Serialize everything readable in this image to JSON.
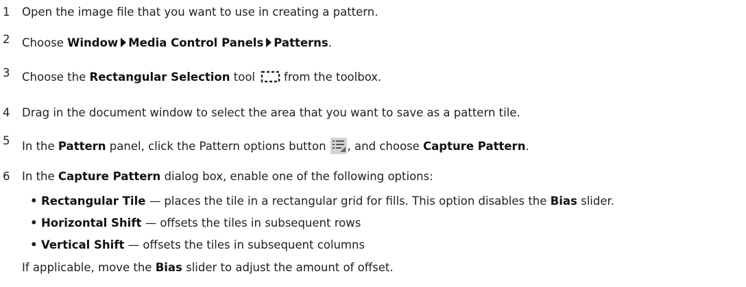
{
  "steps": [
    {
      "num": "1",
      "t": "Open the image file that you want to use in creating a pattern."
    },
    {
      "num": "2",
      "pre": "Choose",
      "m1": "Window",
      "m2": "Media Control Panels",
      "m3": "Patterns",
      "post": "."
    },
    {
      "num": "3",
      "pre": "Choose the",
      "tool": "Rectangular Selection",
      "mid": "tool",
      "post": "from the toolbox."
    },
    {
      "num": "4",
      "t": "Drag in the document window to select the area that you want to save as a pattern tile."
    },
    {
      "num": "5",
      "pre": "In the",
      "panel": "Pattern",
      "mid": "panel, click the Pattern options button",
      "mid2": ", and choose",
      "cmd": "Capture Pattern",
      "post": "."
    },
    {
      "num": "6",
      "pre": "In the",
      "dlg": "Capture Pattern",
      "post": "dialog box, enable one of the following options:"
    }
  ],
  "bullets": [
    {
      "name": "Rectangular Tile",
      "desc": "— places the tile in a rectangular grid for fills. This option disables the",
      "bias": "Bias",
      "end": "slider."
    },
    {
      "name": "Horizontal Shift",
      "desc": "— offsets the tiles in subsequent rows"
    },
    {
      "name": "Vertical Shift",
      "desc": "— offsets the tiles in subsequent columns"
    }
  ],
  "final": {
    "pre": "If applicable, move the",
    "bias": "Bias",
    "post": "slider to adjust the amount of offset."
  },
  "icons": {
    "bullet_glyph": "•",
    "selection_tool_icon": "rectangular-selection-icon",
    "pattern_options_icon": "pattern-options-icon"
  }
}
